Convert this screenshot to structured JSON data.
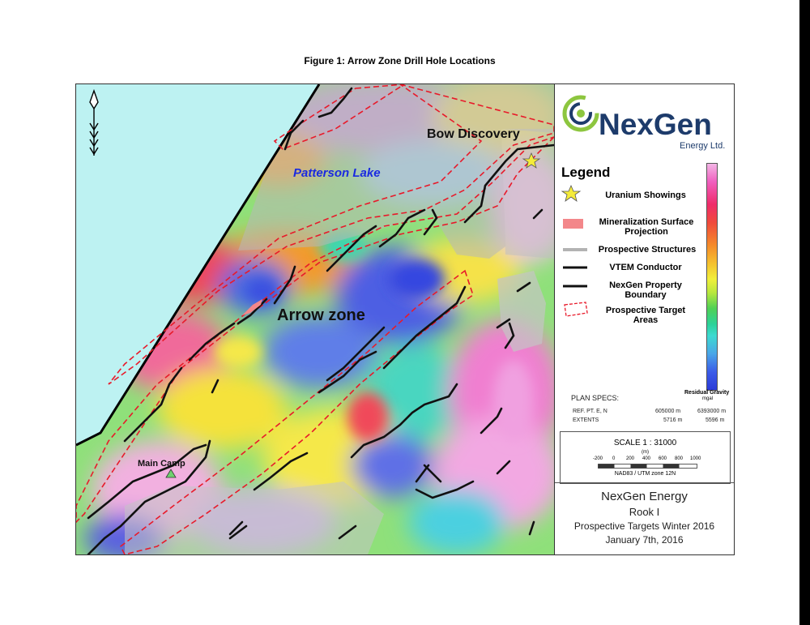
{
  "figure_title": "Figure 1: Arrow Zone Drill Hole Locations",
  "map": {
    "labels": {
      "lake": "Patterson Lake",
      "bow": "Bow Discovery",
      "arrow": "Arrow zone",
      "camp": "Main Camp"
    }
  },
  "panel": {
    "logo_brand": "NexGen",
    "logo_sub": "Energy Ltd.",
    "legend_title": "Legend",
    "legend_items": {
      "uranium": "Uranium Showings",
      "mineralization": "Mineralization Surface Projection",
      "structures": "Prospective Structures",
      "vtem": "VTEM Conductor",
      "boundary": "NexGen Property Boundary",
      "targets": "Prospective Target Areas"
    },
    "colorbar": {
      "title": "Residual Gravity",
      "unit": "mgal",
      "colors": [
        "#f3b6e6",
        "#f05fbf",
        "#ef2c6a",
        "#f58a2a",
        "#f1ef3a",
        "#4fd155",
        "#3ddad0",
        "#3b5ce8",
        "#2b3bd8"
      ]
    },
    "specs": {
      "title": "PLAN SPECS:",
      "ref_label": "REF. PT. E, N",
      "ref_e": "605000 m",
      "ref_n": "6393000 m",
      "extents_label": "EXTENTS",
      "extents_e": "5716 m",
      "extents_n": "5596 m"
    },
    "scale": {
      "label": "SCALE 1 : 31000",
      "unit": "(m)",
      "ticks": [
        "-200",
        "0",
        "200",
        "400",
        "600",
        "800",
        "1000"
      ],
      "datum": "NAD83 / UTM zone 12N"
    },
    "title_block": {
      "company": "NexGen Energy",
      "project": "Rook I",
      "subtitle": "Prospective Targets Winter 2016",
      "date": "January 7th, 2016"
    }
  }
}
